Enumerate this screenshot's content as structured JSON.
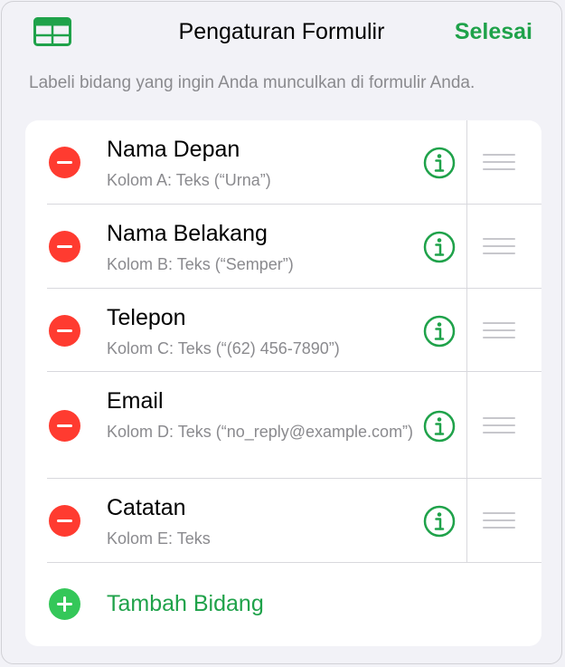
{
  "header": {
    "title": "Pengaturan Formulir",
    "done_label": "Selesai",
    "left_icon": "table-icon"
  },
  "subtitle": "Labeli bidang yang ingin Anda munculkan di formulir Anda.",
  "fields": [
    {
      "label": "Nama Depan",
      "detail": "Kolom A: Teks (“Urna”)"
    },
    {
      "label": "Nama Belakang",
      "detail": "Kolom B: Teks (“Semper”)"
    },
    {
      "label": "Telepon",
      "detail": "Kolom C: Teks (“(62) 456-7890”)"
    },
    {
      "label": "Email",
      "detail": "Kolom D: Teks (“no_reply@example.com”)"
    },
    {
      "label": "Catatan",
      "detail": "Kolom E: Teks"
    }
  ],
  "add_field_label": "Tambah Bidang",
  "colors": {
    "accent": "#1fa24a",
    "delete": "#ff3b30",
    "add": "#34c759",
    "secondary_text": "#8a8a8e"
  },
  "icons": {
    "delete": "minus-circle-icon",
    "info": "info-circle-icon",
    "reorder": "drag-handle-icon",
    "add": "plus-circle-icon"
  }
}
